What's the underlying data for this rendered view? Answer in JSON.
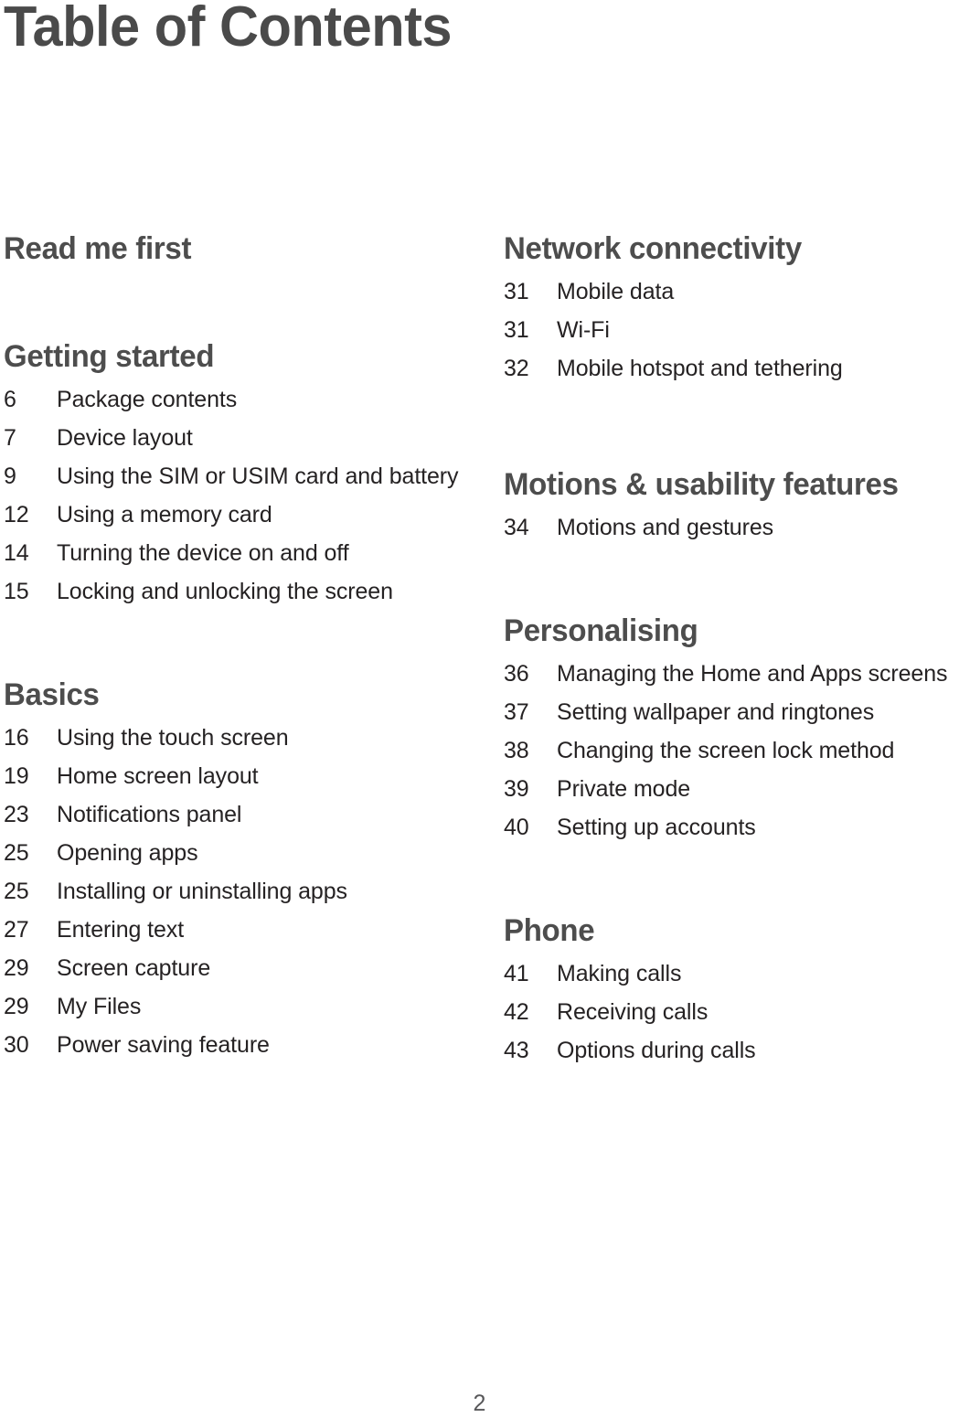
{
  "document": {
    "title": "Table of Contents",
    "page_number": "2"
  },
  "columns": {
    "left": [
      {
        "heading": "Read me first",
        "entries": []
      },
      {
        "heading": "Getting started",
        "entries": [
          {
            "page": "6",
            "title": "Package contents"
          },
          {
            "page": "7",
            "title": "Device layout"
          },
          {
            "page": "9",
            "title": "Using the SIM or USIM card and battery"
          },
          {
            "page": "12",
            "title": "Using a memory card"
          },
          {
            "page": "14",
            "title": "Turning the device on and off"
          },
          {
            "page": "15",
            "title": "Locking and unlocking the screen"
          }
        ]
      },
      {
        "heading": "Basics",
        "entries": [
          {
            "page": "16",
            "title": "Using the touch screen"
          },
          {
            "page": "19",
            "title": "Home screen layout"
          },
          {
            "page": "23",
            "title": "Notifications panel"
          },
          {
            "page": "25",
            "title": "Opening apps"
          },
          {
            "page": "25",
            "title": "Installing or uninstalling apps"
          },
          {
            "page": "27",
            "title": "Entering text"
          },
          {
            "page": "29",
            "title": "Screen capture"
          },
          {
            "page": "29",
            "title": "My Files"
          },
          {
            "page": "30",
            "title": "Power saving feature"
          }
        ]
      }
    ],
    "right": [
      {
        "heading": "Network connectivity",
        "entries": [
          {
            "page": "31",
            "title": "Mobile data"
          },
          {
            "page": "31",
            "title": "Wi-Fi"
          },
          {
            "page": "32",
            "title": "Mobile hotspot and tethering"
          }
        ]
      },
      {
        "heading": "Motions & usability features",
        "entries": [
          {
            "page": "34",
            "title": "Motions and gestures"
          }
        ]
      },
      {
        "heading": "Personalising",
        "entries": [
          {
            "page": "36",
            "title": "Managing the Home and Apps screens"
          },
          {
            "page": "37",
            "title": "Setting wallpaper and ringtones"
          },
          {
            "page": "38",
            "title": "Changing the screen lock method"
          },
          {
            "page": "39",
            "title": "Private mode"
          },
          {
            "page": "40",
            "title": "Setting up accounts"
          }
        ]
      },
      {
        "heading": "Phone",
        "entries": [
          {
            "page": "41",
            "title": "Making calls"
          },
          {
            "page": "42",
            "title": "Receiving calls"
          },
          {
            "page": "43",
            "title": "Options during calls"
          }
        ]
      }
    ]
  }
}
